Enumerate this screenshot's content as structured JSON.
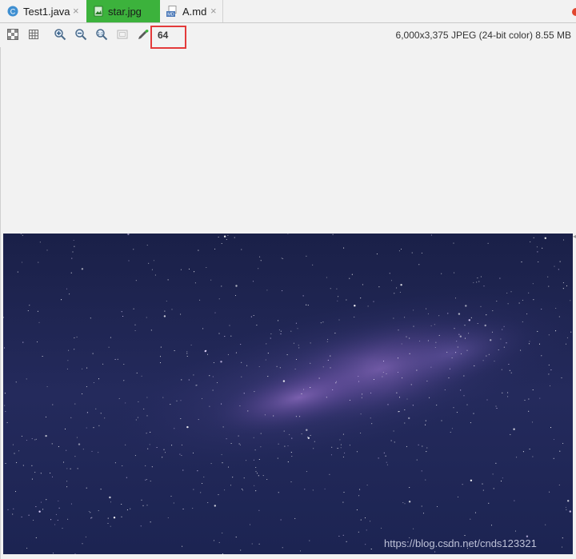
{
  "tabs": [
    {
      "label": "Test1.java",
      "icon": "java-class-icon",
      "active": false,
      "close": "×"
    },
    {
      "label": "star.jpg",
      "icon": "image-file-icon",
      "active": true
    },
    {
      "label": "A.md",
      "icon": "markdown-file-icon",
      "active": false,
      "close": "×"
    }
  ],
  "toolbar": {
    "buttons": [
      "chessboard-background-icon",
      "grid-icon",
      "zoom-in-icon",
      "zoom-out-icon",
      "actual-size-icon",
      "fit-zoom-icon",
      "color-picker-icon"
    ],
    "zoom_value": "64",
    "image_info": "6,000x3,375 JPEG (24-bit color) 8.55 MB"
  },
  "image": {
    "subject": "starry night sky (milky way)",
    "colors": {
      "base": "#1e2450",
      "glow": "#7a5aa8",
      "star": "#ffffff"
    }
  },
  "watermark": "https://blog.csdn.net/cnds123321",
  "colors": {
    "active_tab": "#3cb23c",
    "highlight_box": "#e33a3a",
    "toolbar_bg": "#f2f2f2"
  }
}
